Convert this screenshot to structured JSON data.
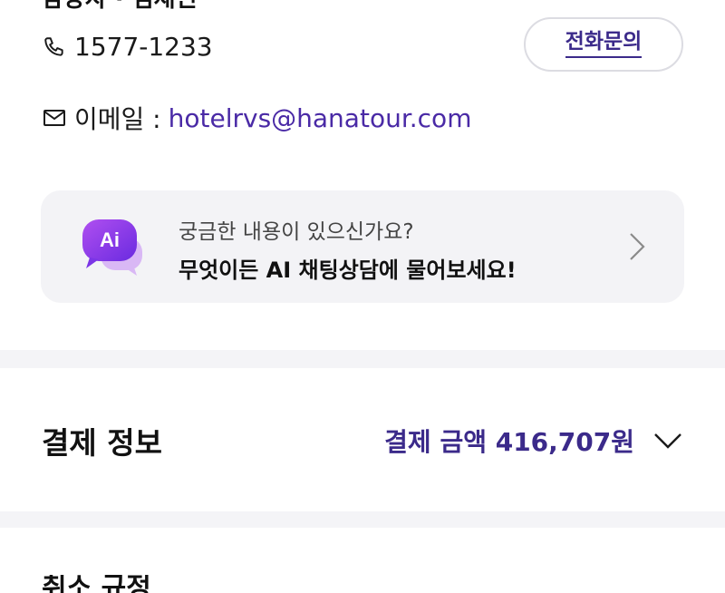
{
  "header": {
    "cut_title": "담당자 · 김채린"
  },
  "contact": {
    "phone_icon": "phone-icon",
    "phone": "1577-1233",
    "call_button": "전화문의",
    "email_icon": "mail-icon",
    "email_label": "이메일 :",
    "email": "hotelrvs@hanatour.com"
  },
  "ai_card": {
    "badge": "Ai",
    "line1": "궁금한 내용이 있으신가요?",
    "line2": "무엇이든 AI 채팅상담에 물어보세요!",
    "chevron_icon": "chevron-right-icon"
  },
  "payment": {
    "title": "결제 정보",
    "amount": "결제 금액 416,707원",
    "chevron_icon": "chevron-down-icon"
  },
  "next_section": {
    "cut_title": "취소 규정"
  },
  "colors": {
    "accent": "#3b2a8a",
    "link": "#4a2aa6",
    "card_bg": "#f3f3f6",
    "ai_badge": "#8a2be2"
  }
}
